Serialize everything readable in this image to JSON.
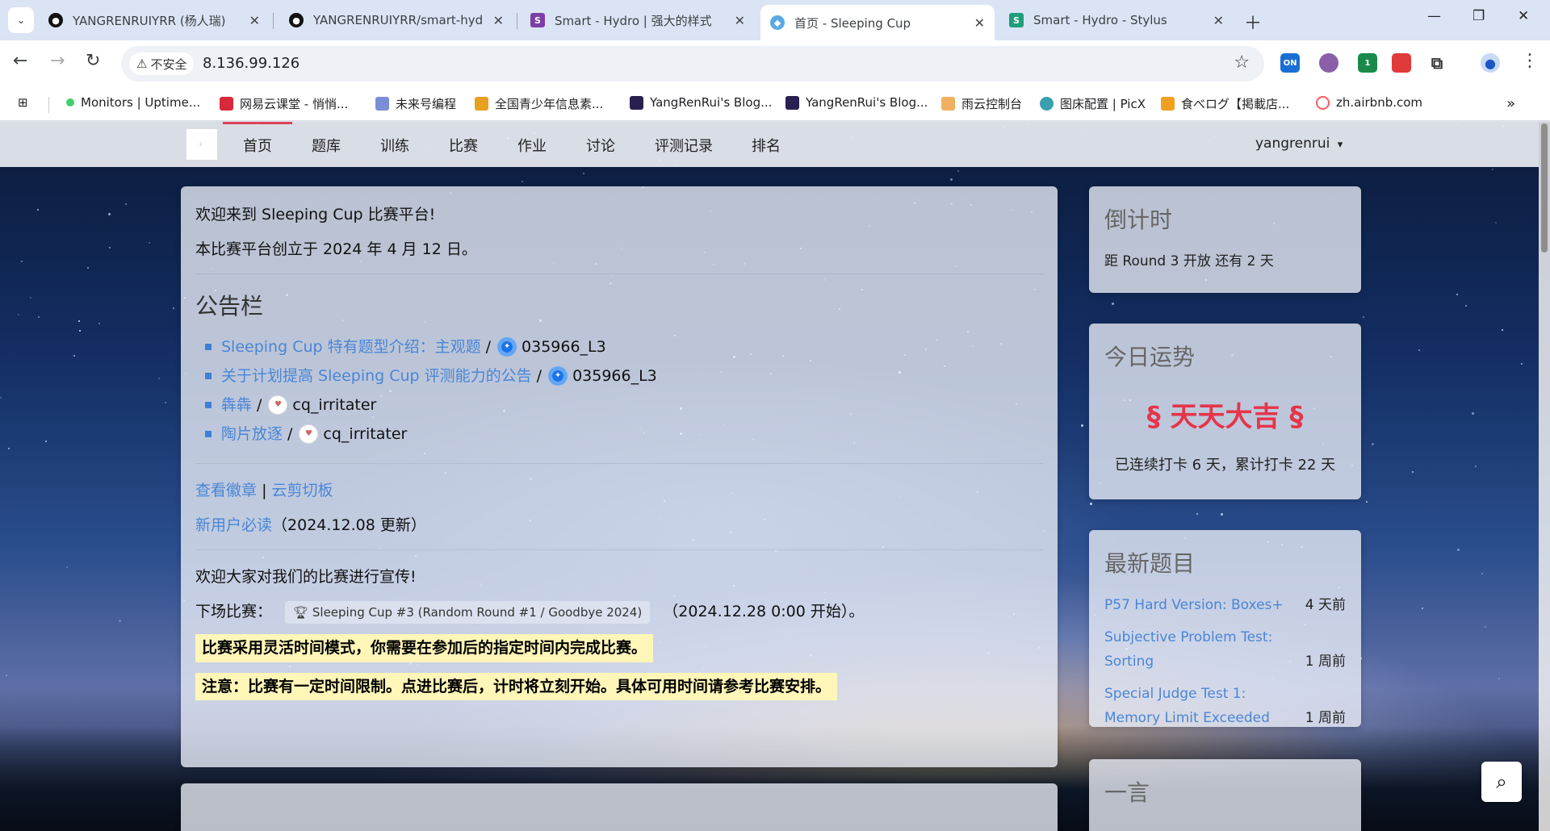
{
  "tabs": [
    {
      "title": "YANGRENRUIYRR (杨人瑞)",
      "icon": "github-icon"
    },
    {
      "title": "YANGRENRUIYRR/smart-hyd",
      "icon": "github-icon"
    },
    {
      "title": "Smart - Hydro | 强大的样式",
      "icon": "stylus-icon"
    },
    {
      "title": "首页 - Sleeping Cup",
      "icon": "hydro-icon",
      "active": true
    },
    {
      "title": "Smart - Hydro - Stylus",
      "icon": "stylus-s-icon"
    }
  ],
  "toolbar": {
    "security_label": "不安全",
    "url": "8.136.99.126",
    "ext_on_badge": "ON",
    "ext_count_badge": "1"
  },
  "bookmarks": [
    "Monitors | Uptime...",
    "网易云课堂 - 悄悄...",
    "未来号编程",
    "全国青少年信息素...",
    "YangRenRui's Blog...",
    "YangRenRui's Blog...",
    "雨云控制台",
    "图床配置 | PicX",
    "食べログ【掲載店...",
    "zh.airbnb.com"
  ],
  "site_nav": {
    "items": [
      "首页",
      "题库",
      "训练",
      "比赛",
      "作业",
      "讨论",
      "评测记录",
      "排名"
    ],
    "username": "yangrenrui",
    "user_caret": "▾"
  },
  "main": {
    "welcome": "欢迎来到 Sleeping Cup 比赛平台!",
    "founded": "本比赛平台创立于 2024 年 4 月 12 日。",
    "ann_title": "公告栏",
    "announcements": [
      {
        "title": "Sleeping Cup 特有题型介绍：主观题",
        "author": "035966_L3"
      },
      {
        "title": "关于计划提高 Sleeping Cup 评测能力的公告",
        "author": "035966_L3"
      },
      {
        "title": "犇犇",
        "author": "cq_irritater"
      },
      {
        "title": "陶片放逐",
        "author": "cq_irritater"
      }
    ],
    "sep": "/",
    "link_badges": "查看徽章",
    "pipe": "|",
    "link_clipboard": "云剪切板",
    "link_newuser": "新用户必读",
    "newuser_note": "（2024.12.08 更新）",
    "promo": "欢迎大家对我们的比赛进行宣传!",
    "next_label": "下场比赛：",
    "next_contest": "Sleeping Cup #3 (Random Round #1 / Goodbye 2024)",
    "next_time": "（2024.12.28 0:00 开始）。",
    "note1": "比赛采用灵活时间模式，你需要在参加后的指定时间内完成比赛。",
    "note2": "注意：比赛有一定时间限制。点进比赛后，计时将立刻开始。具体可用时间请参考比赛安排。"
  },
  "countdown": {
    "title": "倒计时",
    "text": "距 Round 3 开放 还有 2 天"
  },
  "fortune": {
    "title": "今日运势",
    "result": "§ 天天大吉 §",
    "streak": "已连续打卡 6 天，累计打卡 22 天"
  },
  "latest": {
    "title": "最新题目",
    "problems": [
      {
        "name": "P57 Hard Version: Boxes+",
        "age": "4 天前"
      },
      {
        "name": "Subjective Problem Test: Sorting",
        "age": "1 周前"
      },
      {
        "name": "Special Judge Test 1: Memory Limit Exceeded",
        "age": "1 周前"
      }
    ]
  },
  "hitokoto": {
    "title": "一言"
  },
  "colors": {
    "accent": "#4a86d6",
    "fortune_red": "#e6344a",
    "nav_active": "#e0405a"
  }
}
